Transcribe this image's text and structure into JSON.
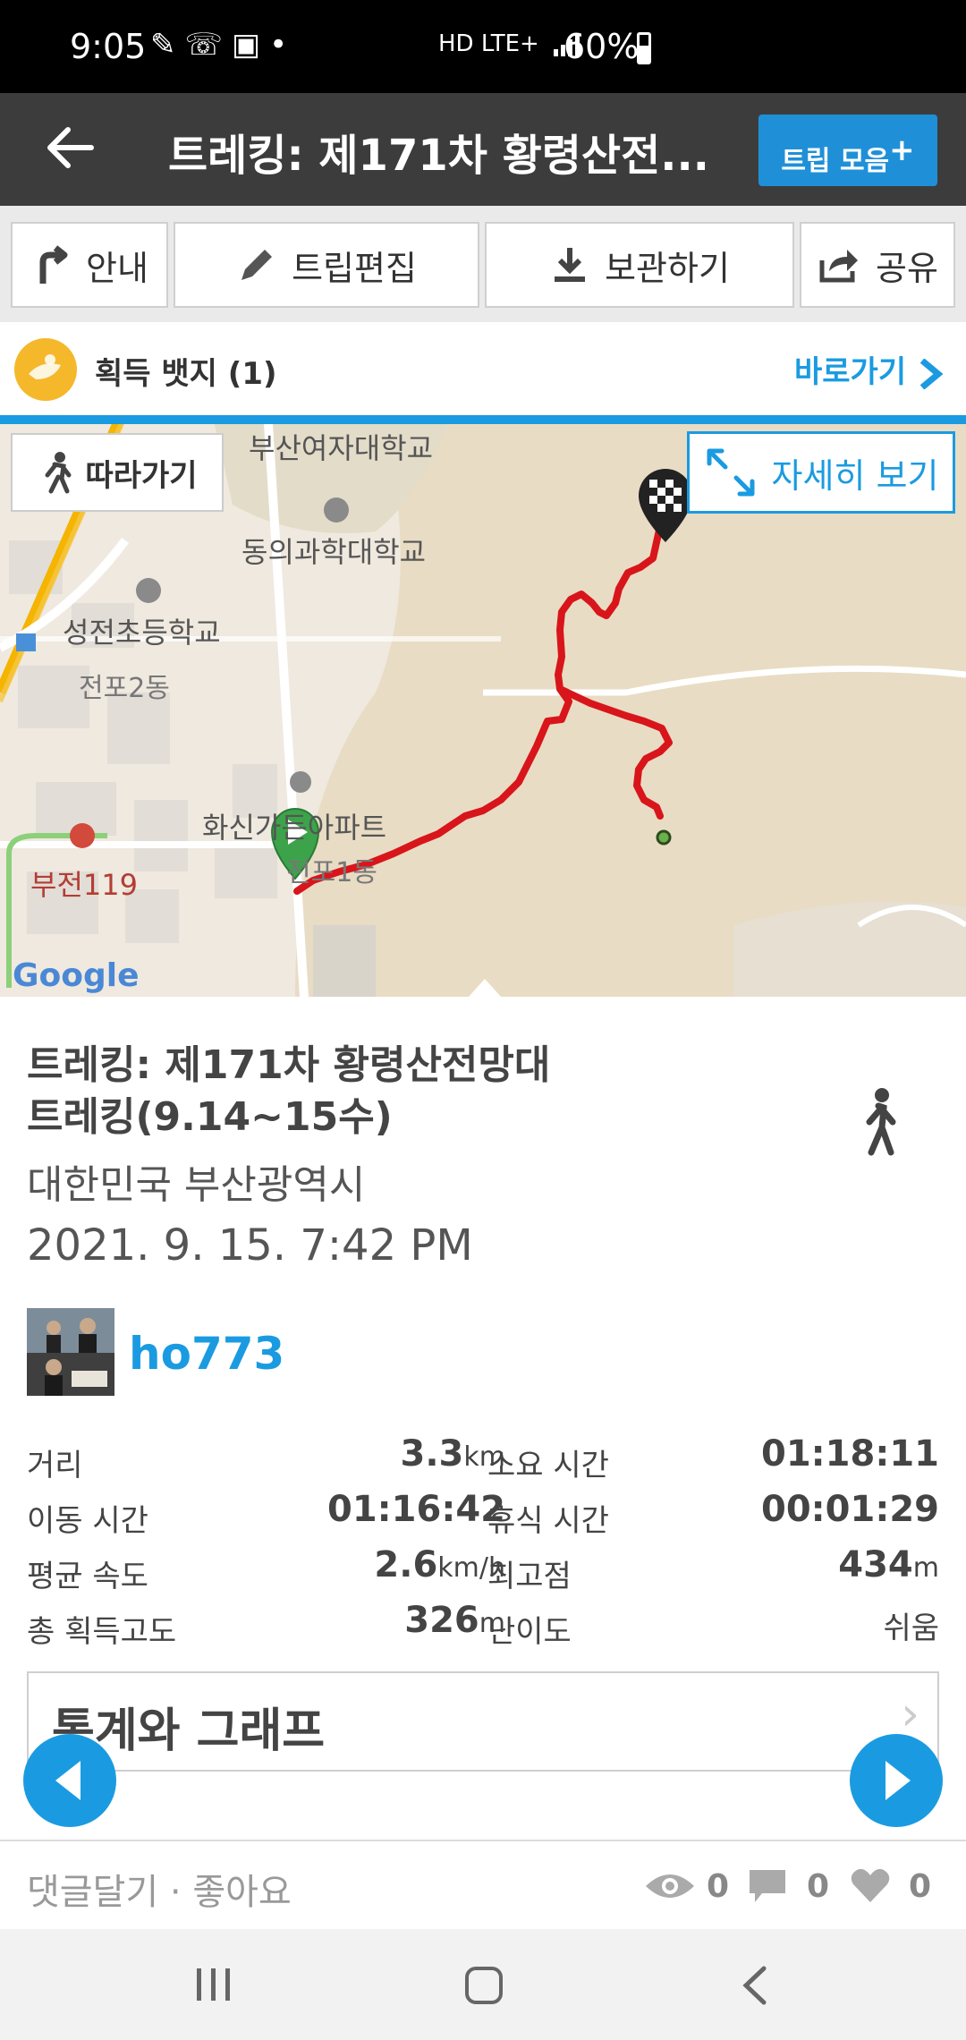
{
  "status_bar": {
    "time": "9:05",
    "network": "HD LTE+",
    "battery": "60%",
    "battery_level": 0.6
  },
  "header": {
    "title": "트레킹: 제171차 황령산전...",
    "trip_collection_label": "트립 모음",
    "trip_collection_plus": "+"
  },
  "toolbar": {
    "guide": "안내",
    "edit": "트립편집",
    "save": "보관하기",
    "share": "공유"
  },
  "badges": {
    "label": "획득 뱃지 (1)",
    "goto": "바로가기"
  },
  "map": {
    "follow_label": "따라가기",
    "detail_label": "자세히 보기",
    "place_labels": [
      "부산여자대학교",
      "동의과학대학교",
      "성전초등학교",
      "전포2동",
      "화신가든아파트",
      "부전119",
      "전포1동"
    ],
    "attribution": "Google",
    "route_color": "#d8151b"
  },
  "trip": {
    "title_line1": "트레킹: 제171차 황령산전망대",
    "title_line2": "트레킹(9.14~15수)",
    "location": "대한민국 부산광역시",
    "datetime": "2021. 9. 15. 7:42 PM",
    "username": "ho773"
  },
  "stats": [
    {
      "label": "거리",
      "value": "3.3",
      "unit": "km"
    },
    {
      "label": "소요 시간",
      "value": "01:18:11",
      "unit": ""
    },
    {
      "label": "이동 시간",
      "value": "01:16:42",
      "unit": ""
    },
    {
      "label": "휴식 시간",
      "value": "00:01:29",
      "unit": ""
    },
    {
      "label": "평균 속도",
      "value": "2.6",
      "unit": "km/h"
    },
    {
      "label": "최고점",
      "value": "434",
      "unit": "m"
    },
    {
      "label": "총 획득고도",
      "value": "326",
      "unit": "m"
    },
    {
      "label": "난이도",
      "value": "쉬움",
      "unit": ""
    }
  ],
  "stats_section": {
    "title": "통계와 그래프",
    "chevron": "›"
  },
  "footer": {
    "comment_like": "댓글달기 · 좋아요",
    "views": "0",
    "comments": "0",
    "likes": "0"
  },
  "colors": {
    "accent": "#1a9be1",
    "header_bg": "#3c3c3c"
  }
}
